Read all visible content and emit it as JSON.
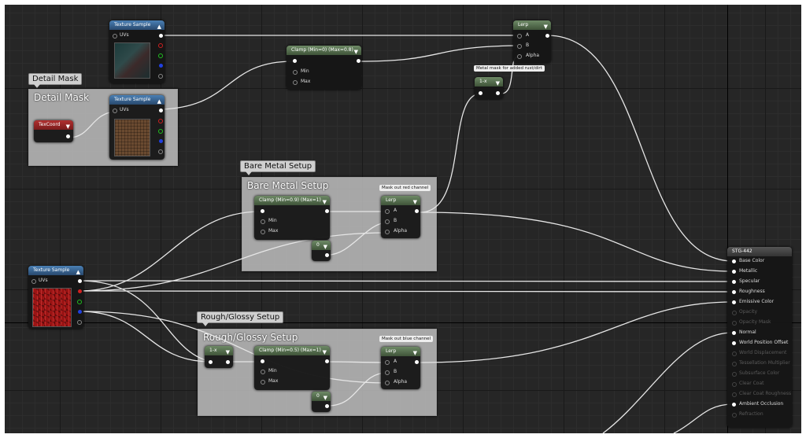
{
  "comments": {
    "detail_mask": {
      "tag": "Detail Mask",
      "title": "Detail Mask"
    },
    "bare_metal": {
      "tag": "Bare Metal Setup",
      "title": "Bare Metal Setup",
      "note": "Mask out red channel"
    },
    "rough_glossy": {
      "tag": "Rough/Glossy Setup",
      "title": "Rough/Glossy Setup",
      "note": "Mask out blue channel"
    }
  },
  "tooltips": {
    "metal_mask": "Metal mask for added rust/dirt"
  },
  "nodes": {
    "tex_top": {
      "title": "Texture Sample",
      "input": "UVs"
    },
    "tex_detail": {
      "title": "Texture Sample",
      "input": "UVs"
    },
    "tex_main": {
      "title": "Texture Sample",
      "input": "UVs"
    },
    "texcoord": {
      "title": "TexCoord"
    },
    "clamp_top": {
      "title": "Clamp (Min=0) (Max=0.8)",
      "min": "Min",
      "max": "Max"
    },
    "lerp_top": {
      "title": "Lerp",
      "a": "A",
      "b": "B",
      "alpha": "Alpha"
    },
    "oneminus_top": {
      "title": "1-x"
    },
    "clamp_metal": {
      "title": "Clamp (Min=0.9) (Max=1)",
      "min": "Min",
      "max": "Max"
    },
    "lerp_metal": {
      "title": "Lerp",
      "a": "A",
      "b": "B",
      "alpha": "Alpha"
    },
    "const_metal": {
      "title": "0"
    },
    "oneminus_rough": {
      "title": "1-x"
    },
    "clamp_rough": {
      "title": "Clamp (Min=0.5) (Max=1)",
      "min": "Min",
      "max": "Max"
    },
    "lerp_rough": {
      "title": "Lerp",
      "a": "A",
      "b": "B",
      "alpha": "Alpha"
    },
    "const_rough": {
      "title": "0"
    }
  },
  "material": {
    "title": "STG-442",
    "inputs": [
      {
        "label": "Base Color",
        "active": true
      },
      {
        "label": "Metallic",
        "active": true
      },
      {
        "label": "Specular",
        "active": true
      },
      {
        "label": "Roughness",
        "active": true
      },
      {
        "label": "Emissive Color",
        "active": true
      },
      {
        "label": "Opacity",
        "active": false
      },
      {
        "label": "Opacity Mask",
        "active": false
      },
      {
        "label": "Normal",
        "active": true
      },
      {
        "label": "World Position Offset",
        "active": true
      },
      {
        "label": "World Displacement",
        "active": false
      },
      {
        "label": "Tessellation Multiplier",
        "active": false
      },
      {
        "label": "Subsurface Color",
        "active": false
      },
      {
        "label": "Clear Coat",
        "active": false
      },
      {
        "label": "Clear Coat Roughness",
        "active": false
      },
      {
        "label": "Ambient Occlusion",
        "active": true
      },
      {
        "label": "Refraction",
        "active": false
      }
    ]
  },
  "colors": {
    "red": "#d02020",
    "green": "#20c020",
    "blue": "#2040e0",
    "wire": "#e6e6e6"
  }
}
